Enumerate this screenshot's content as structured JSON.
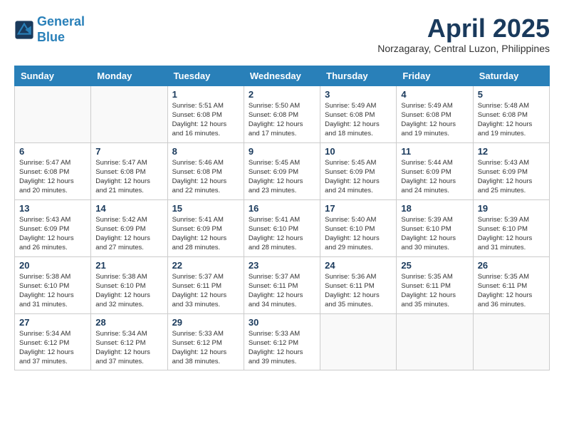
{
  "header": {
    "logo_line1": "General",
    "logo_line2": "Blue",
    "month": "April 2025",
    "location": "Norzagaray, Central Luzon, Philippines"
  },
  "weekdays": [
    "Sunday",
    "Monday",
    "Tuesday",
    "Wednesday",
    "Thursday",
    "Friday",
    "Saturday"
  ],
  "weeks": [
    [
      {
        "day": "",
        "info": ""
      },
      {
        "day": "",
        "info": ""
      },
      {
        "day": "1",
        "info": "Sunrise: 5:51 AM\nSunset: 6:08 PM\nDaylight: 12 hours and 16 minutes."
      },
      {
        "day": "2",
        "info": "Sunrise: 5:50 AM\nSunset: 6:08 PM\nDaylight: 12 hours and 17 minutes."
      },
      {
        "day": "3",
        "info": "Sunrise: 5:49 AM\nSunset: 6:08 PM\nDaylight: 12 hours and 18 minutes."
      },
      {
        "day": "4",
        "info": "Sunrise: 5:49 AM\nSunset: 6:08 PM\nDaylight: 12 hours and 19 minutes."
      },
      {
        "day": "5",
        "info": "Sunrise: 5:48 AM\nSunset: 6:08 PM\nDaylight: 12 hours and 19 minutes."
      }
    ],
    [
      {
        "day": "6",
        "info": "Sunrise: 5:47 AM\nSunset: 6:08 PM\nDaylight: 12 hours and 20 minutes."
      },
      {
        "day": "7",
        "info": "Sunrise: 5:47 AM\nSunset: 6:08 PM\nDaylight: 12 hours and 21 minutes."
      },
      {
        "day": "8",
        "info": "Sunrise: 5:46 AM\nSunset: 6:08 PM\nDaylight: 12 hours and 22 minutes."
      },
      {
        "day": "9",
        "info": "Sunrise: 5:45 AM\nSunset: 6:09 PM\nDaylight: 12 hours and 23 minutes."
      },
      {
        "day": "10",
        "info": "Sunrise: 5:45 AM\nSunset: 6:09 PM\nDaylight: 12 hours and 24 minutes."
      },
      {
        "day": "11",
        "info": "Sunrise: 5:44 AM\nSunset: 6:09 PM\nDaylight: 12 hours and 24 minutes."
      },
      {
        "day": "12",
        "info": "Sunrise: 5:43 AM\nSunset: 6:09 PM\nDaylight: 12 hours and 25 minutes."
      }
    ],
    [
      {
        "day": "13",
        "info": "Sunrise: 5:43 AM\nSunset: 6:09 PM\nDaylight: 12 hours and 26 minutes."
      },
      {
        "day": "14",
        "info": "Sunrise: 5:42 AM\nSunset: 6:09 PM\nDaylight: 12 hours and 27 minutes."
      },
      {
        "day": "15",
        "info": "Sunrise: 5:41 AM\nSunset: 6:09 PM\nDaylight: 12 hours and 28 minutes."
      },
      {
        "day": "16",
        "info": "Sunrise: 5:41 AM\nSunset: 6:10 PM\nDaylight: 12 hours and 28 minutes."
      },
      {
        "day": "17",
        "info": "Sunrise: 5:40 AM\nSunset: 6:10 PM\nDaylight: 12 hours and 29 minutes."
      },
      {
        "day": "18",
        "info": "Sunrise: 5:39 AM\nSunset: 6:10 PM\nDaylight: 12 hours and 30 minutes."
      },
      {
        "day": "19",
        "info": "Sunrise: 5:39 AM\nSunset: 6:10 PM\nDaylight: 12 hours and 31 minutes."
      }
    ],
    [
      {
        "day": "20",
        "info": "Sunrise: 5:38 AM\nSunset: 6:10 PM\nDaylight: 12 hours and 31 minutes."
      },
      {
        "day": "21",
        "info": "Sunrise: 5:38 AM\nSunset: 6:10 PM\nDaylight: 12 hours and 32 minutes."
      },
      {
        "day": "22",
        "info": "Sunrise: 5:37 AM\nSunset: 6:11 PM\nDaylight: 12 hours and 33 minutes."
      },
      {
        "day": "23",
        "info": "Sunrise: 5:37 AM\nSunset: 6:11 PM\nDaylight: 12 hours and 34 minutes."
      },
      {
        "day": "24",
        "info": "Sunrise: 5:36 AM\nSunset: 6:11 PM\nDaylight: 12 hours and 35 minutes."
      },
      {
        "day": "25",
        "info": "Sunrise: 5:35 AM\nSunset: 6:11 PM\nDaylight: 12 hours and 35 minutes."
      },
      {
        "day": "26",
        "info": "Sunrise: 5:35 AM\nSunset: 6:11 PM\nDaylight: 12 hours and 36 minutes."
      }
    ],
    [
      {
        "day": "27",
        "info": "Sunrise: 5:34 AM\nSunset: 6:12 PM\nDaylight: 12 hours and 37 minutes."
      },
      {
        "day": "28",
        "info": "Sunrise: 5:34 AM\nSunset: 6:12 PM\nDaylight: 12 hours and 37 minutes."
      },
      {
        "day": "29",
        "info": "Sunrise: 5:33 AM\nSunset: 6:12 PM\nDaylight: 12 hours and 38 minutes."
      },
      {
        "day": "30",
        "info": "Sunrise: 5:33 AM\nSunset: 6:12 PM\nDaylight: 12 hours and 39 minutes."
      },
      {
        "day": "",
        "info": ""
      },
      {
        "day": "",
        "info": ""
      },
      {
        "day": "",
        "info": ""
      }
    ]
  ]
}
